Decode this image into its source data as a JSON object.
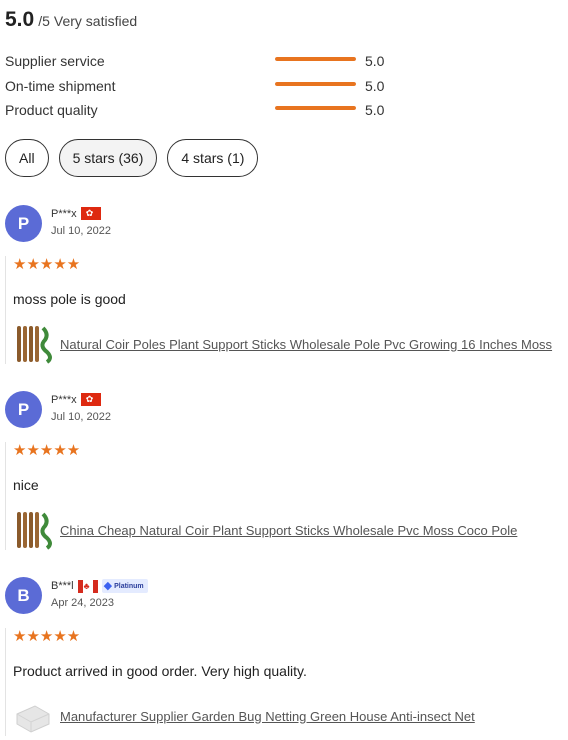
{
  "summary": {
    "score": "5.0",
    "max": "/5",
    "text": "Very satisfied"
  },
  "metrics": [
    {
      "label": "Supplier service",
      "value": "5.0",
      "fill_fraction": 1.0
    },
    {
      "label": "On-time shipment",
      "value": "5.0",
      "fill_fraction": 1.0
    },
    {
      "label": "Product quality",
      "value": "5.0",
      "fill_fraction": 1.0
    }
  ],
  "filters": [
    {
      "label": "All",
      "active": false
    },
    {
      "label": "5 stars (36)",
      "active": true
    },
    {
      "label": "4 stars (1)",
      "active": false
    }
  ],
  "colors": {
    "accent": "#e8741f",
    "avatar": "#5b6bd6"
  },
  "reviews": [
    {
      "avatar": "P",
      "name": "P***x",
      "flag": "hong-kong-flag-icon",
      "date": "Jul 10, 2022",
      "stars": "★★★★★",
      "rating": 5,
      "comment": "moss pole is good",
      "product": "Natural Coir Poles Plant Support Sticks Wholesale Pole Pvc Growing 16 Inches Moss"
    },
    {
      "avatar": "P",
      "name": "P***x",
      "flag": "hong-kong-flag-icon",
      "date": "Jul 10, 2022",
      "stars": "★★★★★",
      "rating": 5,
      "comment": "nice",
      "product": "China Cheap Natural Coir Plant Support Sticks Wholesale Pvc Moss Coco Pole"
    },
    {
      "avatar": "B",
      "name": "B***l",
      "flag": "canada-flag-icon",
      "badge": "Platinum",
      "date": "Apr 24, 2023",
      "stars": "★★★★★",
      "rating": 5,
      "comment": "Product arrived in good order. Very high quality.",
      "product": "Manufacturer Supplier Garden Bug Netting Green House Anti-insect Net"
    }
  ]
}
